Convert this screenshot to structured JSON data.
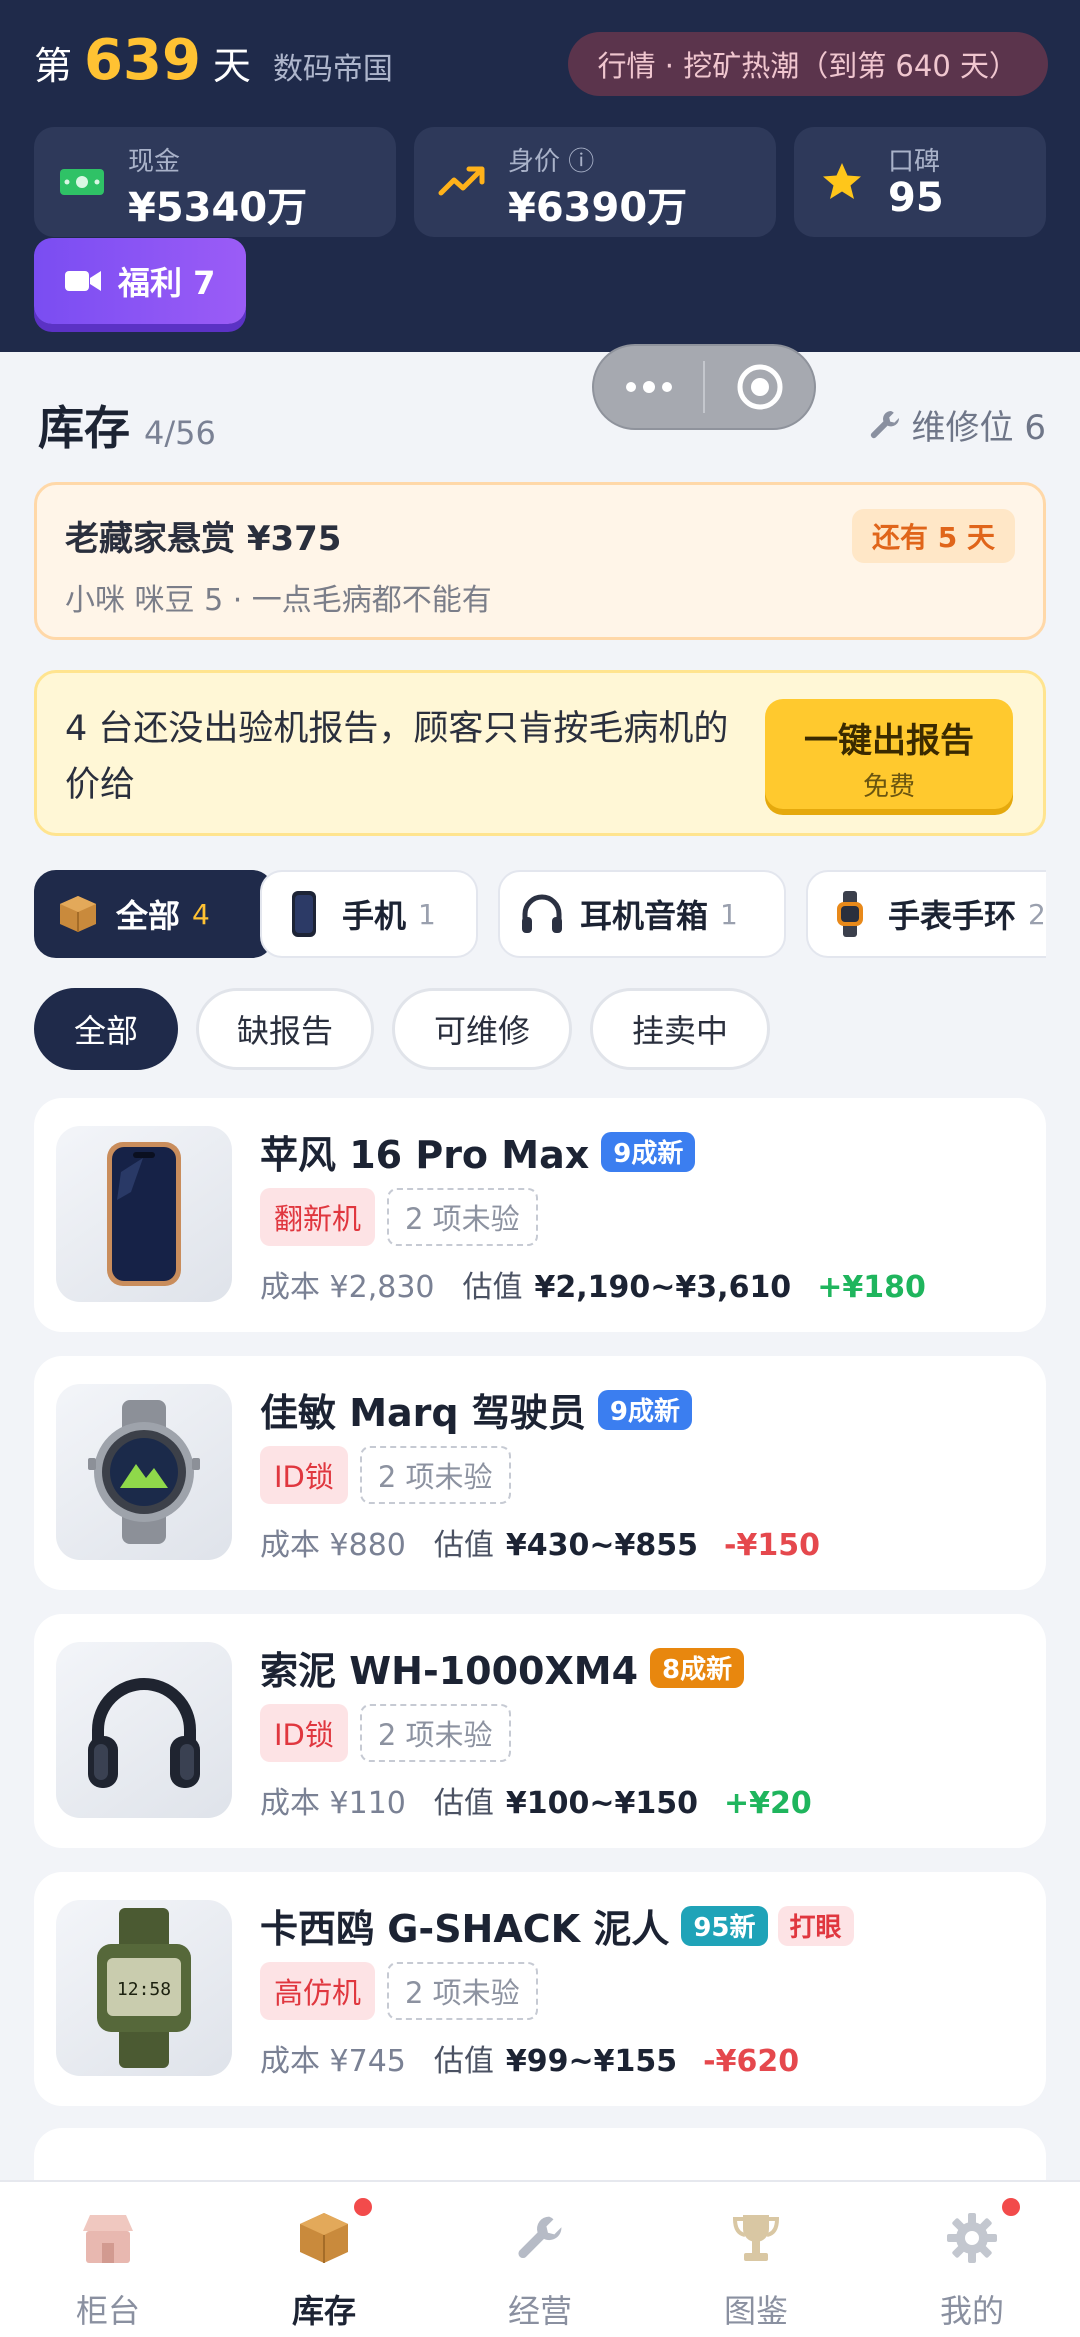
{
  "header": {
    "day_prefix": "第",
    "day_number": "639",
    "day_suffix": "天",
    "brand": "数码帝国",
    "market": "行情 · 挖矿热潮（到第 640 天）",
    "stats": [
      {
        "label": "现金",
        "value": "¥5340万",
        "icon": "cash-icon"
      },
      {
        "label": "身价 ⓘ",
        "value": "¥6390万",
        "icon": "trend-up-icon"
      },
      {
        "label": "口碑",
        "value": "95",
        "icon": "star-icon"
      }
    ],
    "welfare": "福利 7"
  },
  "inventory": {
    "title": "库存",
    "count": "4/56",
    "repair": "维修位 6"
  },
  "bounty": {
    "title": "老藏家悬赏 ¥375",
    "subtitle": "小咪 咪豆 5 · 一点毛病都不能有",
    "days": "还有 5 天"
  },
  "report": {
    "text": "4 台还没出验机报告，顾客只肯按毛病机的价给",
    "button": "一键出报告",
    "button_sub": "免费"
  },
  "categories": [
    {
      "label": "全部",
      "count": "4"
    },
    {
      "label": "手机",
      "count": "1"
    },
    {
      "label": "耳机音箱",
      "count": "1"
    },
    {
      "label": "手表手环",
      "count": "2"
    }
  ],
  "filters": [
    "全部",
    "缺报告",
    "可维修",
    "挂卖中"
  ],
  "items": [
    {
      "name": "苹风 16 Pro Max",
      "condition": "9成新",
      "condition_color": "#3b7ef0",
      "flag": "",
      "tag": "翻新机",
      "unverified": "2 项未验",
      "cost": "成本 ¥2,830",
      "est_label": "估值",
      "range": "¥2,190~¥3,610",
      "profit": "+¥180"
    },
    {
      "name": "佳敏 Marq 驾驶员",
      "condition": "9成新",
      "condition_color": "#3b7ef0",
      "flag": "",
      "tag": "ID锁",
      "unverified": "2 项未验",
      "cost": "成本 ¥880",
      "est_label": "估值",
      "range": "¥430~¥855",
      "profit": "-¥150"
    },
    {
      "name": "索泥 WH-1000XM4",
      "condition": "8成新",
      "condition_color": "#e8870e",
      "flag": "",
      "tag": "ID锁",
      "unverified": "2 项未验",
      "cost": "成本 ¥110",
      "est_label": "估值",
      "range": "¥100~¥150",
      "profit": "+¥20"
    },
    {
      "name": "卡西鸥 G-SHACK 泥人",
      "condition": "95新",
      "condition_color": "#1fa3b8",
      "flag": "打眼",
      "tag": "高仿机",
      "unverified": "2 项未验",
      "cost": "成本 ¥745",
      "est_label": "估值",
      "range": "¥99~¥155",
      "profit": "-¥620"
    }
  ],
  "watch_display": "12:58",
  "nav": [
    {
      "label": "柜台",
      "icon": "store-icon"
    },
    {
      "label": "库存",
      "icon": "box-icon"
    },
    {
      "label": "经营",
      "icon": "wrench-icon"
    },
    {
      "label": "图鉴",
      "icon": "trophy-icon"
    },
    {
      "label": "我的",
      "icon": "gear-icon"
    }
  ]
}
